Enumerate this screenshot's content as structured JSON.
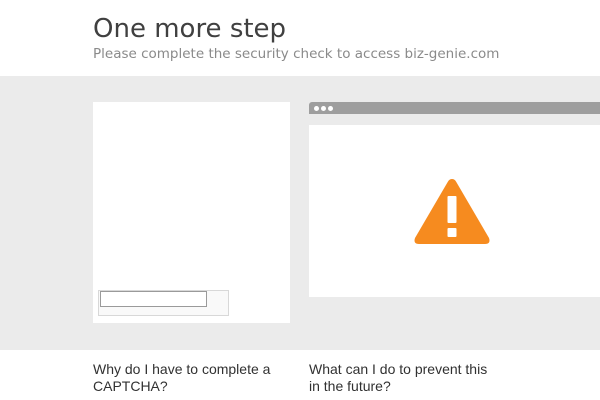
{
  "header": {
    "title": "One more step",
    "subtitle": "Please complete the security check to access biz-genie.com"
  },
  "captcha": {
    "input_value": ""
  },
  "browser_illustration": {
    "icon": "warning-triangle-icon",
    "icon_color": "#f68b1f",
    "bar_color": "#9e9e9e"
  },
  "faq": [
    {
      "question": "Why do I have to complete a CAPTCHA?"
    },
    {
      "question": "What can I do to prevent this in the future?"
    }
  ],
  "colors": {
    "title": "#404040",
    "subtitle": "#8a8a8a",
    "band_background": "#ebebeb"
  }
}
